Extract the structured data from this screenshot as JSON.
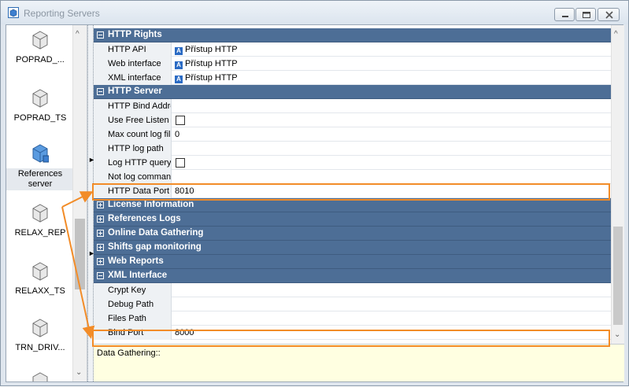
{
  "window": {
    "title": "Reporting Servers"
  },
  "left_panel": {
    "items": [
      {
        "label": "POPRAD_..."
      },
      {
        "label": "POPRAD_TS"
      },
      {
        "label": "References server"
      },
      {
        "label": "RELAX_REP"
      },
      {
        "label": "RELAXX_TS"
      },
      {
        "label": "TRN_DRIV..."
      }
    ]
  },
  "grid": {
    "http_rights": {
      "title": "HTTP Rights",
      "rows": [
        {
          "name": "HTTP API",
          "value": "Přístup HTTP"
        },
        {
          "name": "Web interface",
          "value": "Přístup HTTP"
        },
        {
          "name": "XML interface",
          "value": "Přístup HTTP"
        }
      ]
    },
    "http_server": {
      "title": "HTTP Server",
      "rows": [
        {
          "name": "HTTP Bind Addre",
          "value": ""
        },
        {
          "name": "Use Free Listen F",
          "value": ""
        },
        {
          "name": "Max count log file",
          "value": "0"
        },
        {
          "name": "HTTP log path",
          "value": ""
        },
        {
          "name": "Log HTTP query",
          "value": ""
        },
        {
          "name": "Not log command",
          "value": ""
        },
        {
          "name": "HTTP Data Port",
          "value": "8010"
        }
      ]
    },
    "collapsed": [
      "License Information",
      "References Logs",
      "Online Data Gathering",
      "Shifts gap monitoring",
      "Web Reports"
    ],
    "xml_interface": {
      "title": "XML Interface",
      "rows": [
        {
          "name": "Crypt Key",
          "value": ""
        },
        {
          "name": "Debug Path",
          "value": ""
        },
        {
          "name": "Files Path",
          "value": ""
        },
        {
          "name": "Bind Port",
          "value": "8000"
        }
      ]
    }
  },
  "description": {
    "text": "Data Gathering::"
  },
  "colors": {
    "category_header": "#4d6e96",
    "highlight": "#f28c28",
    "description_bg": "#ffffe1"
  }
}
